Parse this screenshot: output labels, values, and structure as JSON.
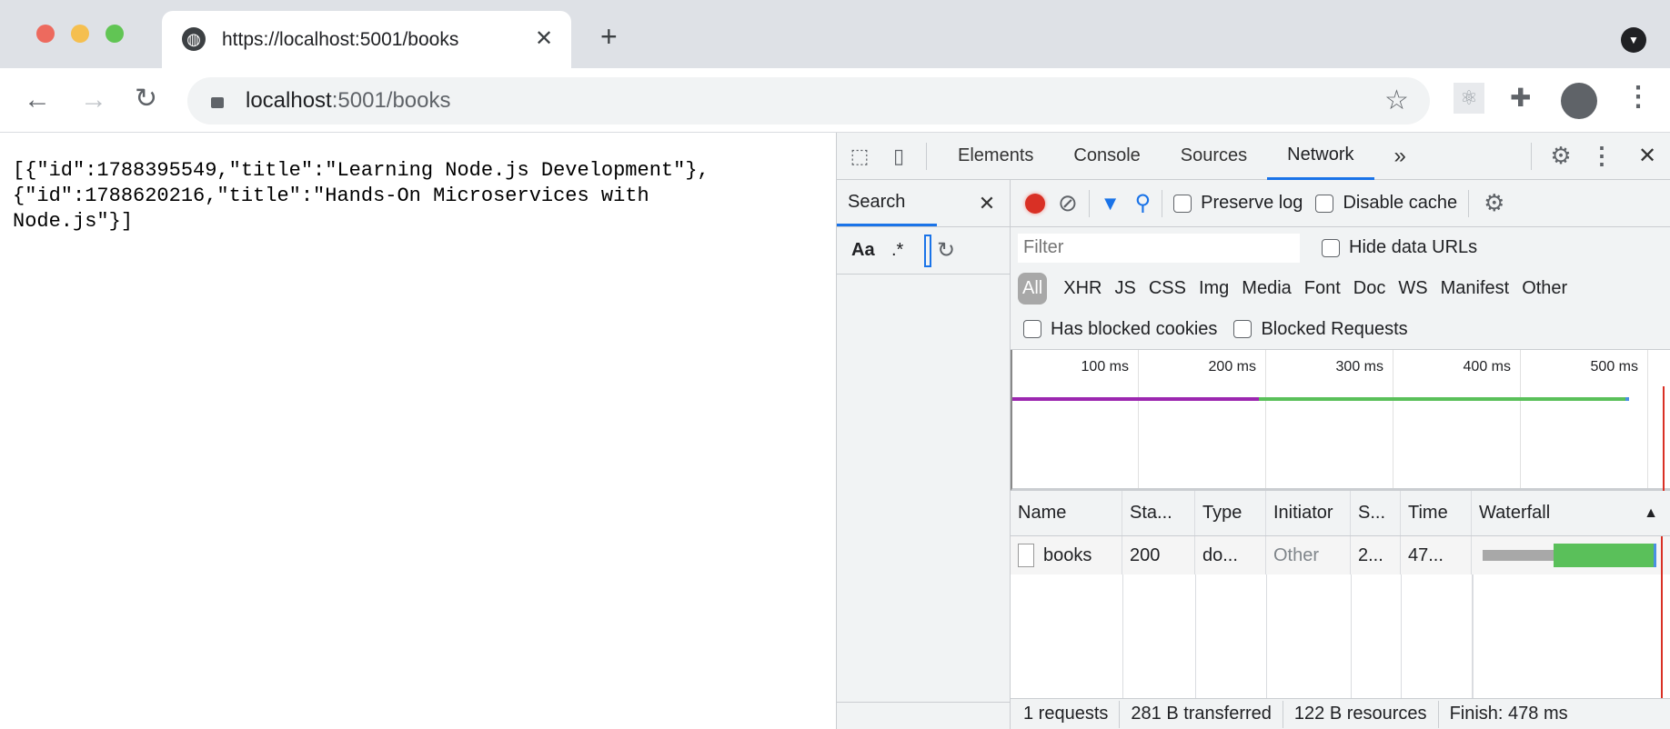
{
  "browser": {
    "tab_title": "https://localhost:5001/books",
    "url_host": "localhost",
    "url_rest": ":5001/books"
  },
  "page": {
    "body_text": "[{\"id\":1788395549,\"title\":\"Learning Node.js Development\"},\n{\"id\":1788620216,\"title\":\"Hands-On Microservices with\nNode.js\"}]"
  },
  "devtools": {
    "tabs": [
      "Elements",
      "Console",
      "Sources",
      "Network"
    ],
    "more": "»",
    "search": {
      "label": "Search",
      "case": "Aa",
      "regex": ".*"
    },
    "network": {
      "preserve_log": "Preserve log",
      "disable_cache": "Disable cache",
      "filter_placeholder": "Filter",
      "hide_data_urls": "Hide data URLs",
      "types": [
        "All",
        "XHR",
        "JS",
        "CSS",
        "Img",
        "Media",
        "Font",
        "Doc",
        "WS",
        "Manifest",
        "Other"
      ],
      "has_blocked_cookies": "Has blocked cookies",
      "blocked_requests": "Blocked Requests",
      "timeline_ticks": [
        "100 ms",
        "200 ms",
        "300 ms",
        "400 ms",
        "500 ms"
      ],
      "columns": [
        "Name",
        "Sta...",
        "Type",
        "Initiator",
        "S...",
        "Time",
        "Waterfall"
      ],
      "rows": [
        {
          "name": "books",
          "status": "200",
          "type": "do...",
          "initiator": "Other",
          "size": "2...",
          "time": "47..."
        }
      ],
      "status": {
        "requests": "1 requests",
        "transferred": "281 B transferred",
        "resources": "122 B resources",
        "finish": "Finish: 478 ms"
      }
    }
  }
}
